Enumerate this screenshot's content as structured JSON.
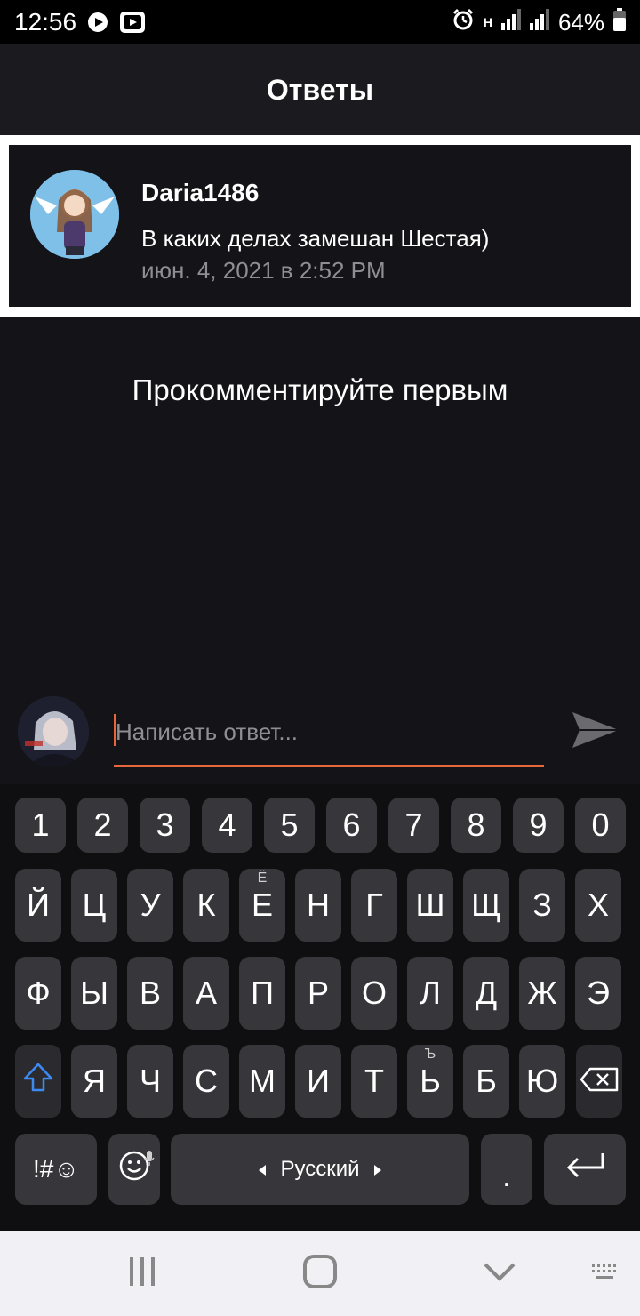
{
  "status_bar": {
    "time": "12:56",
    "battery": "64%",
    "net": "H"
  },
  "header": {
    "title": "Ответы"
  },
  "comment": {
    "username": "Daria1486",
    "text": "В каких делах замешан Шестая)",
    "date": "июн. 4, 2021 в 2:52 PM"
  },
  "empty_state": {
    "text": "Прокомментируйте первым"
  },
  "reply": {
    "placeholder": "Написать ответ..."
  },
  "keyboard": {
    "row_numbers": [
      "1",
      "2",
      "3",
      "4",
      "5",
      "6",
      "7",
      "8",
      "9",
      "0"
    ],
    "row1": [
      "Й",
      "Ц",
      "У",
      "К",
      "Е",
      "Н",
      "Г",
      "Ш",
      "Щ",
      "З",
      "Х"
    ],
    "row1_hints": [
      "",
      "",
      "",
      "",
      "Ё",
      "",
      "",
      "",
      "",
      "",
      ""
    ],
    "row2": [
      "Ф",
      "Ы",
      "В",
      "А",
      "П",
      "Р",
      "О",
      "Л",
      "Д",
      "Ж",
      "Э"
    ],
    "row3": [
      "Я",
      "Ч",
      "С",
      "М",
      "И",
      "Т",
      "Ь",
      "Б",
      "Ю"
    ],
    "row3_hints": [
      "",
      "",
      "",
      "",
      "",
      "",
      "Ъ",
      "",
      ""
    ],
    "symbols_label": "!#☺",
    "language_label": "Русский",
    "period_label": "."
  },
  "colors": {
    "accent": "#e8663b",
    "background": "#141317",
    "header": "#1b1a1e",
    "key": "#37373b"
  },
  "icons": {
    "send": "send-icon",
    "shift": "shift-icon",
    "backspace": "backspace-icon",
    "enter": "enter-icon",
    "emoji": "emoji-icon",
    "mic": "mic-icon"
  }
}
